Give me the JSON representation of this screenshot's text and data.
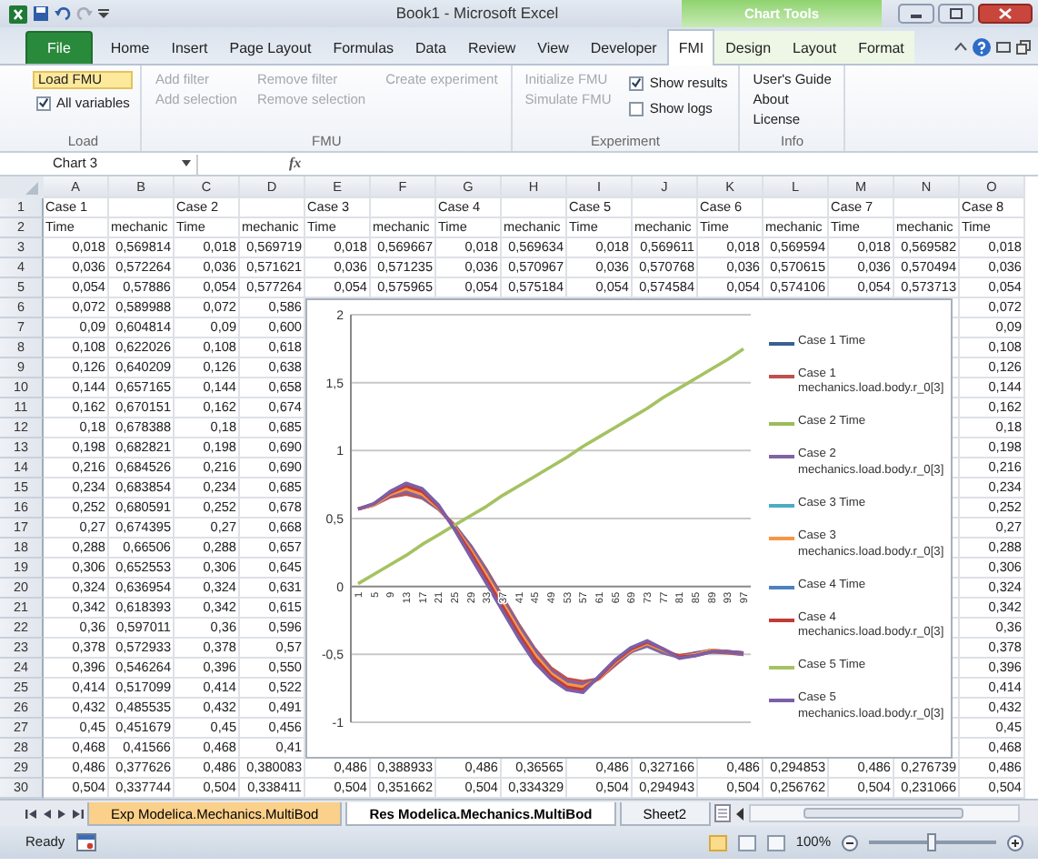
{
  "title_bar": {
    "title": "Book1 - Microsoft Excel",
    "context_label": "Chart Tools"
  },
  "tabs": [
    {
      "label": "File",
      "kind": "file",
      "selected": false
    },
    {
      "label": "Home",
      "kind": "standard",
      "selected": false
    },
    {
      "label": "Insert",
      "kind": "standard",
      "selected": false
    },
    {
      "label": "Page Layout",
      "kind": "standard",
      "selected": false
    },
    {
      "label": "Formulas",
      "kind": "standard",
      "selected": false
    },
    {
      "label": "Data",
      "kind": "standard",
      "selected": false
    },
    {
      "label": "Review",
      "kind": "standard",
      "selected": false
    },
    {
      "label": "View",
      "kind": "standard",
      "selected": false
    },
    {
      "label": "Developer",
      "kind": "standard",
      "selected": false
    },
    {
      "label": "FMI",
      "kind": "standard",
      "selected": true
    },
    {
      "label": "Design",
      "kind": "contextual",
      "selected": false
    },
    {
      "label": "Layout",
      "kind": "contextual",
      "selected": false
    },
    {
      "label": "Format",
      "kind": "contextual",
      "selected": false
    }
  ],
  "ribbon_groups": [
    {
      "label": "Load",
      "columns": [
        [
          {
            "kind": "button",
            "label": "Load FMU",
            "disabled": false,
            "highlighted": true
          },
          {
            "kind": "checkbox",
            "label": "All variables",
            "checked": true
          }
        ]
      ]
    },
    {
      "label": "FMU",
      "columns": [
        [
          {
            "kind": "button",
            "label": "Add filter",
            "disabled": true,
            "highlighted": false
          },
          {
            "kind": "button",
            "label": "Add selection",
            "disabled": true,
            "highlighted": false
          }
        ],
        [
          {
            "kind": "button",
            "label": "Remove filter",
            "disabled": true,
            "highlighted": false
          },
          {
            "kind": "button",
            "label": "Remove selection",
            "disabled": true,
            "highlighted": false
          }
        ],
        [
          {
            "kind": "button",
            "label": "Create experiment",
            "disabled": true,
            "highlighted": false
          }
        ]
      ]
    },
    {
      "label": "Experiment",
      "columns": [
        [
          {
            "kind": "button",
            "label": "Initialize FMU",
            "disabled": true,
            "highlighted": false
          },
          {
            "kind": "button",
            "label": "Simulate FMU",
            "disabled": true,
            "highlighted": false
          }
        ],
        [
          {
            "kind": "checkbox",
            "label": "Show results",
            "checked": true
          },
          {
            "kind": "checkbox",
            "label": "Show logs",
            "checked": false
          }
        ]
      ]
    },
    {
      "label": "Info",
      "columns": [
        [
          {
            "kind": "button",
            "label": "User's Guide",
            "disabled": false,
            "highlighted": false
          },
          {
            "kind": "button",
            "label": "About",
            "disabled": false,
            "highlighted": false
          },
          {
            "kind": "button",
            "label": "License",
            "disabled": false,
            "highlighted": false
          }
        ]
      ]
    }
  ],
  "formula_bar": {
    "name_box": "Chart 3",
    "function_label": "fx"
  },
  "sheet": {
    "columns": [
      "A",
      "B",
      "C",
      "D",
      "E",
      "F",
      "G",
      "H",
      "I",
      "J",
      "K",
      "L",
      "M",
      "N",
      "O"
    ],
    "rows": [
      {
        "header": "1",
        "kind": "text",
        "cells": [
          "Case 1",
          null,
          "Case 2",
          null,
          "Case 3",
          null,
          "Case 4",
          null,
          "Case 5",
          null,
          "Case 6",
          null,
          "Case 7",
          null,
          "Case 8"
        ]
      },
      {
        "header": "2",
        "kind": "text",
        "cells": [
          "Time",
          "mechanic",
          "Time",
          "mechanic",
          "Time",
          "mechanic",
          "Time",
          "mechanic",
          "Time",
          "mechanic",
          "Time",
          "mechanic",
          "Time",
          "mechanic",
          "Time"
        ]
      },
      {
        "header": "3",
        "kind": "number",
        "cells": [
          "0,018",
          "0,569814",
          "0,018",
          "0,569719",
          "0,018",
          "0,569667",
          "0,018",
          "0,569634",
          "0,018",
          "0,569611",
          "0,018",
          "0,569594",
          "0,018",
          "0,569582",
          "0,018"
        ]
      },
      {
        "header": "4",
        "kind": "number",
        "cells": [
          "0,036",
          "0,572264",
          "0,036",
          "0,571621",
          "0,036",
          "0,571235",
          "0,036",
          "0,570967",
          "0,036",
          "0,570768",
          "0,036",
          "0,570615",
          "0,036",
          "0,570494",
          "0,036"
        ]
      },
      {
        "header": "5",
        "kind": "number",
        "cells": [
          "0,054",
          "0,57886",
          "0,054",
          "0,577264",
          "0,054",
          "0,575965",
          "0,054",
          "0,575184",
          "0,054",
          "0,574584",
          "0,054",
          "0,574106",
          "0,054",
          "0,573713",
          "0,054"
        ]
      },
      {
        "header": "6",
        "kind": "number",
        "cells": [
          "0,072",
          "0,589988",
          "0,072",
          "0,586",
          null,
          null,
          null,
          null,
          null,
          null,
          null,
          null,
          null,
          null,
          "0,072"
        ]
      },
      {
        "header": "7",
        "kind": "number",
        "cells": [
          "0,09",
          "0,604814",
          "0,09",
          "0,600",
          null,
          null,
          null,
          null,
          null,
          null,
          null,
          null,
          null,
          null,
          "0,09"
        ]
      },
      {
        "header": "8",
        "kind": "number",
        "cells": [
          "0,108",
          "0,622026",
          "0,108",
          "0,618",
          null,
          null,
          null,
          null,
          null,
          null,
          null,
          null,
          null,
          null,
          "0,108"
        ]
      },
      {
        "header": "9",
        "kind": "number",
        "cells": [
          "0,126",
          "0,640209",
          "0,126",
          "0,638",
          null,
          null,
          null,
          null,
          null,
          null,
          null,
          null,
          null,
          null,
          "0,126"
        ]
      },
      {
        "header": "10",
        "kind": "number",
        "cells": [
          "0,144",
          "0,657165",
          "0,144",
          "0,658",
          null,
          null,
          null,
          null,
          null,
          null,
          null,
          null,
          null,
          null,
          "0,144"
        ]
      },
      {
        "header": "11",
        "kind": "number",
        "cells": [
          "0,162",
          "0,670151",
          "0,162",
          "0,674",
          null,
          null,
          null,
          null,
          null,
          null,
          null,
          null,
          null,
          null,
          "0,162"
        ]
      },
      {
        "header": "12",
        "kind": "number",
        "cells": [
          "0,18",
          "0,678388",
          "0,18",
          "0,685",
          null,
          null,
          null,
          null,
          null,
          null,
          null,
          null,
          null,
          null,
          "0,18"
        ]
      },
      {
        "header": "13",
        "kind": "number",
        "cells": [
          "0,198",
          "0,682821",
          "0,198",
          "0,690",
          null,
          null,
          null,
          null,
          null,
          null,
          null,
          null,
          null,
          null,
          "0,198"
        ]
      },
      {
        "header": "14",
        "kind": "number",
        "cells": [
          "0,216",
          "0,684526",
          "0,216",
          "0,690",
          null,
          null,
          null,
          null,
          null,
          null,
          null,
          null,
          null,
          null,
          "0,216"
        ]
      },
      {
        "header": "15",
        "kind": "number",
        "cells": [
          "0,234",
          "0,683854",
          "0,234",
          "0,685",
          null,
          null,
          null,
          null,
          null,
          null,
          null,
          null,
          null,
          null,
          "0,234"
        ]
      },
      {
        "header": "16",
        "kind": "number",
        "cells": [
          "0,252",
          "0,680591",
          "0,252",
          "0,678",
          null,
          null,
          null,
          null,
          null,
          null,
          null,
          null,
          null,
          null,
          "0,252"
        ]
      },
      {
        "header": "17",
        "kind": "number",
        "cells": [
          "0,27",
          "0,674395",
          "0,27",
          "0,668",
          null,
          null,
          null,
          null,
          null,
          null,
          null,
          null,
          null,
          null,
          "0,27"
        ]
      },
      {
        "header": "18",
        "kind": "number",
        "cells": [
          "0,288",
          "0,66506",
          "0,288",
          "0,657",
          null,
          null,
          null,
          null,
          null,
          null,
          null,
          null,
          null,
          null,
          "0,288"
        ]
      },
      {
        "header": "19",
        "kind": "number",
        "cells": [
          "0,306",
          "0,652553",
          "0,306",
          "0,645",
          null,
          null,
          null,
          null,
          null,
          null,
          null,
          null,
          null,
          null,
          "0,306"
        ]
      },
      {
        "header": "20",
        "kind": "number",
        "cells": [
          "0,324",
          "0,636954",
          "0,324",
          "0,631",
          null,
          null,
          null,
          null,
          null,
          null,
          null,
          null,
          null,
          null,
          "0,324"
        ]
      },
      {
        "header": "21",
        "kind": "number",
        "cells": [
          "0,342",
          "0,618393",
          "0,342",
          "0,615",
          null,
          null,
          null,
          null,
          null,
          null,
          null,
          null,
          null,
          null,
          "0,342"
        ]
      },
      {
        "header": "22",
        "kind": "number",
        "cells": [
          "0,36",
          "0,597011",
          "0,36",
          "0,596",
          null,
          null,
          null,
          null,
          null,
          null,
          null,
          null,
          null,
          null,
          "0,36"
        ]
      },
      {
        "header": "23",
        "kind": "number",
        "cells": [
          "0,378",
          "0,572933",
          "0,378",
          "0,57",
          null,
          null,
          null,
          null,
          null,
          null,
          null,
          null,
          null,
          null,
          "0,378"
        ]
      },
      {
        "header": "24",
        "kind": "number",
        "cells": [
          "0,396",
          "0,546264",
          "0,396",
          "0,550",
          null,
          null,
          null,
          null,
          null,
          null,
          null,
          null,
          null,
          null,
          "0,396"
        ]
      },
      {
        "header": "25",
        "kind": "number",
        "cells": [
          "0,414",
          "0,517099",
          "0,414",
          "0,522",
          null,
          null,
          null,
          null,
          null,
          null,
          null,
          null,
          null,
          null,
          "0,414"
        ]
      },
      {
        "header": "26",
        "kind": "number",
        "cells": [
          "0,432",
          "0,485535",
          "0,432",
          "0,491",
          null,
          null,
          null,
          null,
          null,
          null,
          null,
          null,
          null,
          null,
          "0,432"
        ]
      },
      {
        "header": "27",
        "kind": "number",
        "cells": [
          "0,45",
          "0,451679",
          "0,45",
          "0,456",
          null,
          null,
          null,
          null,
          null,
          null,
          null,
          null,
          null,
          null,
          "0,45"
        ]
      },
      {
        "header": "28",
        "kind": "number",
        "cells": [
          "0,468",
          "0,41566",
          "0,468",
          "0,41",
          null,
          null,
          null,
          null,
          null,
          null,
          null,
          null,
          null,
          null,
          "0,468"
        ]
      },
      {
        "header": "29",
        "kind": "number",
        "cells": [
          "0,486",
          "0,377626",
          "0,486",
          "0,380083",
          "0,486",
          "0,388933",
          "0,486",
          "0,36565",
          "0,486",
          "0,327166",
          "0,486",
          "0,294853",
          "0,486",
          "0,276739",
          "0,486"
        ]
      },
      {
        "header": "30",
        "kind": "number",
        "cells": [
          "0,504",
          "0,337744",
          "0,504",
          "0,338411",
          "0,504",
          "0,351662",
          "0,504",
          "0,334329",
          "0,504",
          "0,294943",
          "0,504",
          "0,256762",
          "0,504",
          "0,231066",
          "0,504"
        ]
      }
    ],
    "chart_data": {
      "type": "line",
      "categories": [
        "1",
        "5",
        "9",
        "13",
        "17",
        "21",
        "25",
        "29",
        "33",
        "37",
        "41",
        "45",
        "49",
        "53",
        "57",
        "61",
        "65",
        "69",
        "73",
        "77",
        "81",
        "85",
        "89",
        "93",
        "97"
      ],
      "ylim": [
        -1,
        2
      ],
      "grid": true,
      "legend": true,
      "yticks": [
        {
          "value": -1,
          "label": "-1"
        },
        {
          "value": -0.5,
          "label": "-0,5"
        },
        {
          "value": 0,
          "label": "0"
        },
        {
          "value": 0.5,
          "label": "0,5"
        },
        {
          "value": 1,
          "label": "1"
        },
        {
          "value": 1.5,
          "label": "1,5"
        },
        {
          "value": 2,
          "label": "2"
        }
      ],
      "series": [
        {
          "name": "Case 1 Time",
          "color": "#3a5f93",
          "values": [
            null,
            null,
            null,
            null,
            null,
            null,
            null,
            null,
            null,
            null,
            null,
            null,
            null,
            null,
            null,
            null,
            null,
            null,
            null,
            null,
            null,
            null,
            null,
            null,
            null
          ]
        },
        {
          "name": "Case 1 mechanics.load.body.r_0[3]",
          "color": "#c0504d",
          "values": [
            0.57,
            0.6,
            0.66,
            0.68,
            0.65,
            0.57,
            0.45,
            0.3,
            0.12,
            -0.08,
            -0.28,
            -0.46,
            -0.6,
            -0.68,
            -0.7,
            -0.68,
            -0.58,
            -0.48,
            -0.43,
            -0.48,
            -0.51,
            -0.49,
            -0.48,
            -0.49,
            -0.5
          ]
        },
        {
          "name": "Case 2 Time",
          "color": "#9bbb59",
          "values": [
            null,
            null,
            null,
            null,
            null,
            null,
            null,
            null,
            null,
            null,
            null,
            null,
            null,
            null,
            null,
            null,
            null,
            null,
            null,
            null,
            null,
            null,
            null,
            null,
            null
          ]
        },
        {
          "name": "Case 2 mechanics.load.body.r_0[3]",
          "color": "#8064a2",
          "values": [
            0.57,
            0.6,
            0.67,
            0.7,
            0.66,
            0.57,
            0.45,
            0.3,
            0.11,
            -0.09,
            -0.29,
            -0.47,
            -0.62,
            -0.7,
            -0.72,
            -0.68,
            -0.57,
            -0.48,
            -0.44,
            -0.49,
            -0.52,
            -0.49,
            -0.47,
            -0.48,
            -0.5
          ]
        },
        {
          "name": "Case 3 Time",
          "color": "#4bacc6",
          "values": [
            null,
            null,
            null,
            null,
            null,
            null,
            null,
            null,
            null,
            null,
            null,
            null,
            null,
            null,
            null,
            null,
            null,
            null,
            null,
            null,
            null,
            null,
            null,
            null,
            null
          ]
        },
        {
          "name": "Case 3 mechanics.load.body.r_0[3]",
          "color": "#f79646",
          "values": [
            0.57,
            0.6,
            0.68,
            0.72,
            0.68,
            0.58,
            0.44,
            0.27,
            0.08,
            -0.12,
            -0.32,
            -0.5,
            -0.64,
            -0.72,
            -0.74,
            -0.68,
            -0.56,
            -0.47,
            -0.42,
            -0.47,
            -0.52,
            -0.5,
            -0.47,
            -0.48,
            -0.49
          ]
        },
        {
          "name": "Case 4 Time",
          "color": "#4f81bd",
          "values": [
            null,
            null,
            null,
            null,
            null,
            null,
            null,
            null,
            null,
            null,
            null,
            null,
            null,
            null,
            null,
            null,
            null,
            null,
            null,
            null,
            null,
            null,
            null,
            null,
            null
          ]
        },
        {
          "name": "Case 4 mechanics.load.body.r_0[3]",
          "color": "#c23b36",
          "values": [
            0.57,
            0.61,
            0.69,
            0.74,
            0.7,
            0.59,
            0.43,
            0.25,
            0.05,
            -0.15,
            -0.35,
            -0.53,
            -0.66,
            -0.74,
            -0.76,
            -0.67,
            -0.55,
            -0.46,
            -0.41,
            -0.46,
            -0.52,
            -0.51,
            -0.48,
            -0.48,
            -0.49
          ]
        },
        {
          "name": "Case 5 Time",
          "color": "#a5c262",
          "values": [
            0.02,
            0.09,
            0.16,
            0.23,
            0.31,
            0.38,
            0.45,
            0.52,
            0.59,
            0.67,
            0.74,
            0.81,
            0.88,
            0.95,
            1.03,
            1.1,
            1.17,
            1.24,
            1.31,
            1.39,
            1.46,
            1.53,
            1.6,
            1.67,
            1.75
          ]
        },
        {
          "name": "Case 5 mechanics.load.body.r_0[3]",
          "color": "#7b5fa8",
          "values": [
            0.57,
            0.61,
            0.7,
            0.76,
            0.72,
            0.6,
            0.42,
            0.22,
            0.02,
            -0.18,
            -0.38,
            -0.56,
            -0.68,
            -0.76,
            -0.78,
            -0.66,
            -0.54,
            -0.45,
            -0.4,
            -0.46,
            -0.53,
            -0.51,
            -0.48,
            -0.48,
            -0.49
          ]
        }
      ]
    }
  },
  "sheet_tabs": [
    {
      "label": "Exp Modelica.Mechanics.MultiBod",
      "selected": false,
      "color": "#fbd08a"
    },
    {
      "label": "Res Modelica.Mechanics.MultiBod",
      "selected": true
    },
    {
      "label": "Sheet2",
      "selected": false
    }
  ],
  "status_bar": {
    "status": "Ready",
    "zoom_label": "100%",
    "zoom": {
      "level": 0.5
    },
    "views": [
      {
        "selected": true
      },
      {
        "selected": false
      },
      {
        "selected": false
      }
    ]
  }
}
